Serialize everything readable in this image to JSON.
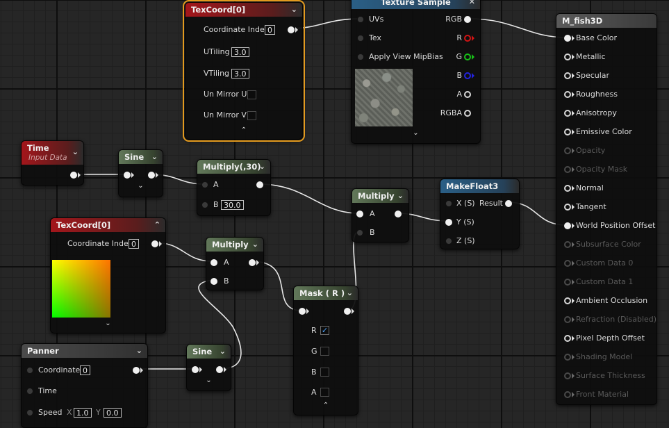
{
  "nodes": {
    "texcoord_top": {
      "title": "TexCoord[0]",
      "coordinate_index_label": "Coordinate Index",
      "coordinate_index": "0",
      "utiling_label": "UTiling",
      "utiling": "3.0",
      "vtiling_label": "VTiling",
      "vtiling": "3.0",
      "unmirror_u_label": "Un Mirror U",
      "unmirror_v_label": "Un Mirror V"
    },
    "texture_sample": {
      "title": "Texture Sample",
      "uvs": "UVs",
      "tex": "Tex",
      "apply_view_mipbias": "Apply View MipBias",
      "rgb": "RGB",
      "r": "R",
      "g": "G",
      "b": "B",
      "a": "A",
      "rgba": "RGBA"
    },
    "output": {
      "title": "M_fish3D",
      "pins": [
        {
          "label": "Base Color",
          "state": "connected"
        },
        {
          "label": "Metallic",
          "state": "active"
        },
        {
          "label": "Specular",
          "state": "active"
        },
        {
          "label": "Roughness",
          "state": "active"
        },
        {
          "label": "Anisotropy",
          "state": "active"
        },
        {
          "label": "Emissive Color",
          "state": "active"
        },
        {
          "label": "Opacity",
          "state": "disabled"
        },
        {
          "label": "Opacity Mask",
          "state": "disabled"
        },
        {
          "label": "Normal",
          "state": "active"
        },
        {
          "label": "Tangent",
          "state": "active"
        },
        {
          "label": "World Position Offset",
          "state": "connected"
        },
        {
          "label": "Subsurface Color",
          "state": "disabled"
        },
        {
          "label": "Custom Data 0",
          "state": "disabled"
        },
        {
          "label": "Custom Data 1",
          "state": "disabled"
        },
        {
          "label": "Ambient Occlusion",
          "state": "active"
        },
        {
          "label": "Refraction (Disabled)",
          "state": "disabled"
        },
        {
          "label": "Pixel Depth Offset",
          "state": "active"
        },
        {
          "label": "Shading Model",
          "state": "disabled"
        },
        {
          "label": "Surface Thickness",
          "state": "disabled"
        },
        {
          "label": "Front Material",
          "state": "disabled"
        }
      ]
    },
    "time": {
      "title": "Time",
      "subtitle": "Input Data"
    },
    "sine_top": {
      "title": "Sine"
    },
    "multiply30": {
      "title": "Multiply(,30)",
      "a": "A",
      "b": "B",
      "b_value": "30.0"
    },
    "multiply_right": {
      "title": "Multiply",
      "a": "A",
      "b": "B"
    },
    "makefloat3": {
      "title": "MakeFloat3",
      "x": "X (S)",
      "y": "Y (S)",
      "z": "Z (S)",
      "result": "Result"
    },
    "texcoord_bottom": {
      "title": "TexCoord[0]",
      "coordinate_index_label": "Coordinate Index",
      "coordinate_index": "0"
    },
    "multiply_mid": {
      "title": "Multiply",
      "a": "A",
      "b": "B"
    },
    "mask": {
      "title": "Mask ( R )",
      "r": "R",
      "g": "G",
      "b": "B",
      "a": "A",
      "r_checked": true,
      "g_checked": false,
      "b_checked": false,
      "a_checked": false,
      "check_mark": "✓"
    },
    "panner": {
      "title": "Panner",
      "coordinate_label": "Coordinate",
      "coordinate": "0",
      "time_label": "Time",
      "speed_label": "Speed",
      "x_label": "X",
      "speed_x": "1.0",
      "y_label": "Y",
      "speed_y": "0.0"
    },
    "sine_bottom": {
      "title": "Sine"
    }
  }
}
